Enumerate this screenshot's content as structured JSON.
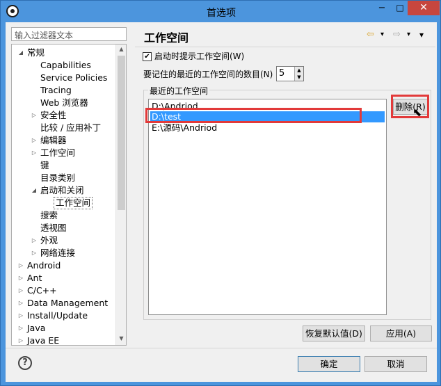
{
  "window": {
    "title": "首选项",
    "minimize": "−",
    "maximize": "□",
    "close": "✕"
  },
  "filter": {
    "placeholder": "输入过滤器文本"
  },
  "tree": {
    "items": [
      {
        "label": "常规",
        "twisty": "◢"
      },
      {
        "label": "Capabilities",
        "twisty": ""
      },
      {
        "label": "Service Policies",
        "twisty": ""
      },
      {
        "label": "Tracing",
        "twisty": ""
      },
      {
        "label": "Web 浏览器",
        "twisty": ""
      },
      {
        "label": "安全性",
        "twisty": "▷"
      },
      {
        "label": "比较 / 应用补丁",
        "twisty": ""
      },
      {
        "label": "编辑器",
        "twisty": "▷"
      },
      {
        "label": "工作空间",
        "twisty": "▷"
      },
      {
        "label": "键",
        "twisty": ""
      },
      {
        "label": "目录类别",
        "twisty": ""
      },
      {
        "label": "启动和关闭",
        "twisty": "◢"
      },
      {
        "label": "工作空间",
        "twisty": ""
      },
      {
        "label": "搜索",
        "twisty": ""
      },
      {
        "label": "透视图",
        "twisty": ""
      },
      {
        "label": "外观",
        "twisty": "▷"
      },
      {
        "label": "网络连接",
        "twisty": "▷"
      },
      {
        "label": "Android",
        "twisty": "▷"
      },
      {
        "label": "Ant",
        "twisty": "▷"
      },
      {
        "label": "C/C++",
        "twisty": "▷"
      },
      {
        "label": "Data Management",
        "twisty": "▷"
      },
      {
        "label": "Install/Update",
        "twisty": "▷"
      },
      {
        "label": "Java",
        "twisty": "▷"
      },
      {
        "label": "Java EE",
        "twisty": "▷"
      }
    ]
  },
  "page": {
    "title": "工作空间",
    "nav": {
      "back": "⇦",
      "dropdown": "▾",
      "forward": "⇨",
      "menu": "▾"
    }
  },
  "options": {
    "prompt_checkbox_label": "启动时提示工作空间(W)",
    "prompt_checked": true,
    "remember_label": "要记住的最近的工作空间的数目(N)",
    "remember_value": "5"
  },
  "recent": {
    "group_label": "最近的工作空间",
    "items": [
      "D:\\Andriod",
      "D:\\test",
      "E:\\源码\\Andriod"
    ],
    "selected_index": 1,
    "remove_label": "删除(R)"
  },
  "buttons": {
    "restore_defaults": "恢复默认值(D)",
    "apply": "应用(A)",
    "ok": "确定",
    "cancel": "取消"
  },
  "help": {
    "glyph": "?"
  },
  "highlight_color": "#e23a3a",
  "selection_color": "#3399ff"
}
